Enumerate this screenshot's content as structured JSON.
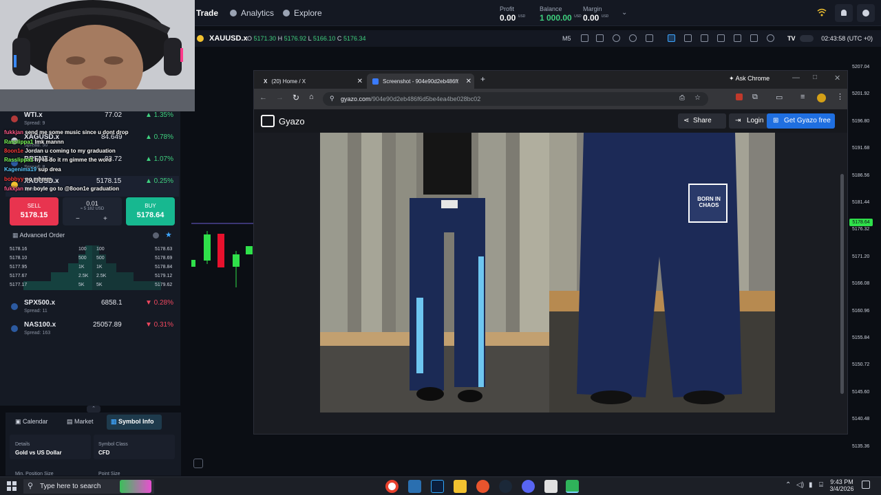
{
  "topbar": {
    "nav": [
      {
        "label": "Trade",
        "icon": "trade-icon"
      },
      {
        "label": "Analytics",
        "icon": "analytics-icon"
      },
      {
        "label": "Explore",
        "icon": "explore-icon"
      }
    ],
    "profit": {
      "label": "Profit",
      "value": "0.00",
      "unit": "USD"
    },
    "balance": {
      "label": "Balance",
      "value": "1 000.00",
      "unit": "USD"
    },
    "margin": {
      "label": "Margin",
      "value": "0.00",
      "unit": "USD"
    }
  },
  "symbolbar": {
    "symbol": "XAUUSD.x",
    "open_label": "O",
    "open": "5171.30",
    "high_label": "H",
    "high": "5176.92",
    "low_label": "L",
    "low": "5166.10",
    "close_label": "C",
    "close": "5176.34",
    "timeframe": "M5",
    "clock": "02:43:58 (UTC +0)"
  },
  "watchlist": [
    {
      "name": "WTI.x",
      "spread": "Spread: 9",
      "price": "77.02",
      "change": "1.35%",
      "direction": "up"
    },
    {
      "name": "XAGUSD.x",
      "spread": "Spread: 50",
      "price": "84.649",
      "change": "0.78%",
      "direction": "up"
    },
    {
      "name": "BRENT.x",
      "spread": "Spread: 8",
      "price": "83.72",
      "change": "1.07%",
      "direction": "up"
    },
    {
      "name": "XAUUSD.x",
      "spread": "Spread: 36",
      "price": "5178.15",
      "change": "0.25%",
      "direction": "up"
    },
    {
      "name": "SPX500.x",
      "spread": "Spread: 11",
      "price": "6858.1",
      "change": "0.28%",
      "direction": "down"
    },
    {
      "name": "NAS100.x",
      "spread": "Spread: 163",
      "price": "25057.89",
      "change": "0.31%",
      "direction": "down"
    }
  ],
  "order": {
    "sell_label": "SELL",
    "sell_price": "5178.15",
    "buy_label": "BUY",
    "buy_price": "5178.64",
    "quantity": "0.01",
    "quantity_usd": "≈ 5 182 USD",
    "minus": "−",
    "plus": "+",
    "advanced_label": "Advanced Order"
  },
  "orderbook": [
    {
      "bid": "5178.16",
      "bid_size": "100",
      "ask_size": "100",
      "ask": "5178.63",
      "bid_fill": 0.1,
      "ask_fill": 0.1
    },
    {
      "bid": "5178.10",
      "bid_size": "500",
      "ask_size": "500",
      "ask": "5178.69",
      "bid_fill": 0.2,
      "ask_fill": 0.2
    },
    {
      "bid": "5177.95",
      "bid_size": "1K",
      "ask_size": "1K",
      "ask": "5178.84",
      "bid_fill": 0.35,
      "ask_fill": 0.35
    },
    {
      "bid": "5177.67",
      "bid_size": "2.5K",
      "ask_size": "2.5K",
      "ask": "5179.12",
      "bid_fill": 0.6,
      "ask_fill": 0.6
    },
    {
      "bid": "5177.17",
      "bid_size": "5K",
      "ask_size": "5K",
      "ask": "5179.62",
      "bid_fill": 1.0,
      "ask_fill": 1.0
    }
  ],
  "chat": [
    {
      "user": "fukkjan",
      "message": "send me some music since u dont drop"
    },
    {
      "user": "Rasslippa1",
      "message": "lmk mannn"
    },
    {
      "user": "8oon1e",
      "message": "Jordan u coming to my graduation"
    },
    {
      "user": "Rasslippa1",
      "message": "hy ld do it rn gimme the word"
    },
    {
      "user": "Kagenima19",
      "message": "sup drea"
    },
    {
      "user": "bobbyy",
      "message": "no mhmm"
    },
    {
      "user": "fukkjan",
      "message": "mr boyle go to @8oon1e graduation"
    }
  ],
  "bottompanel": {
    "tabs": [
      "Calendar",
      "Market",
      "Symbol Info"
    ],
    "details_label": "Details",
    "details_value": "Gold vs US Dollar",
    "class_label": "Symbol Class",
    "class_value": "CFD",
    "min_pos_label": "Min. Position Size",
    "point_label": "Point Size"
  },
  "price_scale": [
    "5207.04",
    "5201.92",
    "5196.80",
    "5191.68",
    "5186.56",
    "5181.44",
    "5176.32",
    "5171.20",
    "5166.08",
    "5160.96",
    "5155.84",
    "5150.72",
    "5145.60",
    "5140.48",
    "5135.36"
  ],
  "current_price_tag": "5178.64",
  "browser": {
    "tabs": [
      {
        "title": "(20) Home / X",
        "icon": "x-logo-icon"
      },
      {
        "title": "Screenshot - 904e90d2eb486f6",
        "icon": "gyazo-tab-icon"
      }
    ],
    "ask_chrome": "Ask Chrome",
    "url_host": "gyazo.com",
    "url_path": "/904e90d2eb486f6d5be4ea4be028bc02",
    "gyazo_logo": "Gyazo",
    "share": "Share",
    "login": "Login",
    "get_free": "Get Gyazo free",
    "pocket_text": "BORN IN CHAOS"
  },
  "taskbar": {
    "search_placeholder": "Type here to search",
    "time": "9:43 PM",
    "date": "3/4/2026"
  }
}
